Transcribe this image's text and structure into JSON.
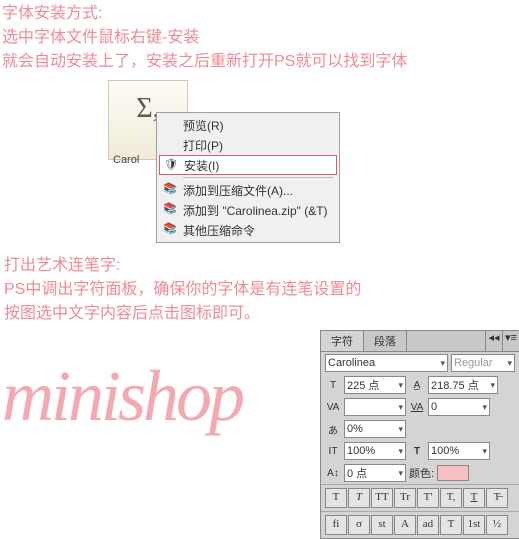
{
  "header1_line1": "字体安装方式:",
  "header1_line2": "选中字体文件鼠标右键-安装",
  "header1_line3": "就会自动安装上了，安装之后重新打开PS就可以找到字体",
  "file_label": "Carol",
  "sigma": "Σ,",
  "ctx": {
    "preview": "预览(R)",
    "print": "打印(P)",
    "install": "安装(I)",
    "addzip": "添加到压缩文件(A)...",
    "addcarol": "添加到 \"Carolinea.zip\" (&T)",
    "otherzip": "其他压缩命令"
  },
  "header2_line1": "打出艺术连笔字:",
  "header2_line2": "PS中调出字符面板，确保你的字体是有连笔设置的",
  "header2_line3": "按图选中文字内容后点击图标即可。",
  "watermark": "minishop",
  "panel": {
    "tab1": "字符",
    "tab2": "段落",
    "font": "Carolinea",
    "style": "Regular",
    "size": "225 点",
    "leading": "218.75 点",
    "metrics": "VA",
    "tracking": "0",
    "vscale": "0%",
    "baseline": "100%",
    "hscale": "100%",
    "shift": "0 点",
    "shift2": "0 点",
    "colorLabel": "颜色:",
    "ot": [
      "T",
      "T",
      "TT",
      "Tr",
      "T'",
      "T,",
      "T",
      "T̶",
      "fi"
    ]
  }
}
